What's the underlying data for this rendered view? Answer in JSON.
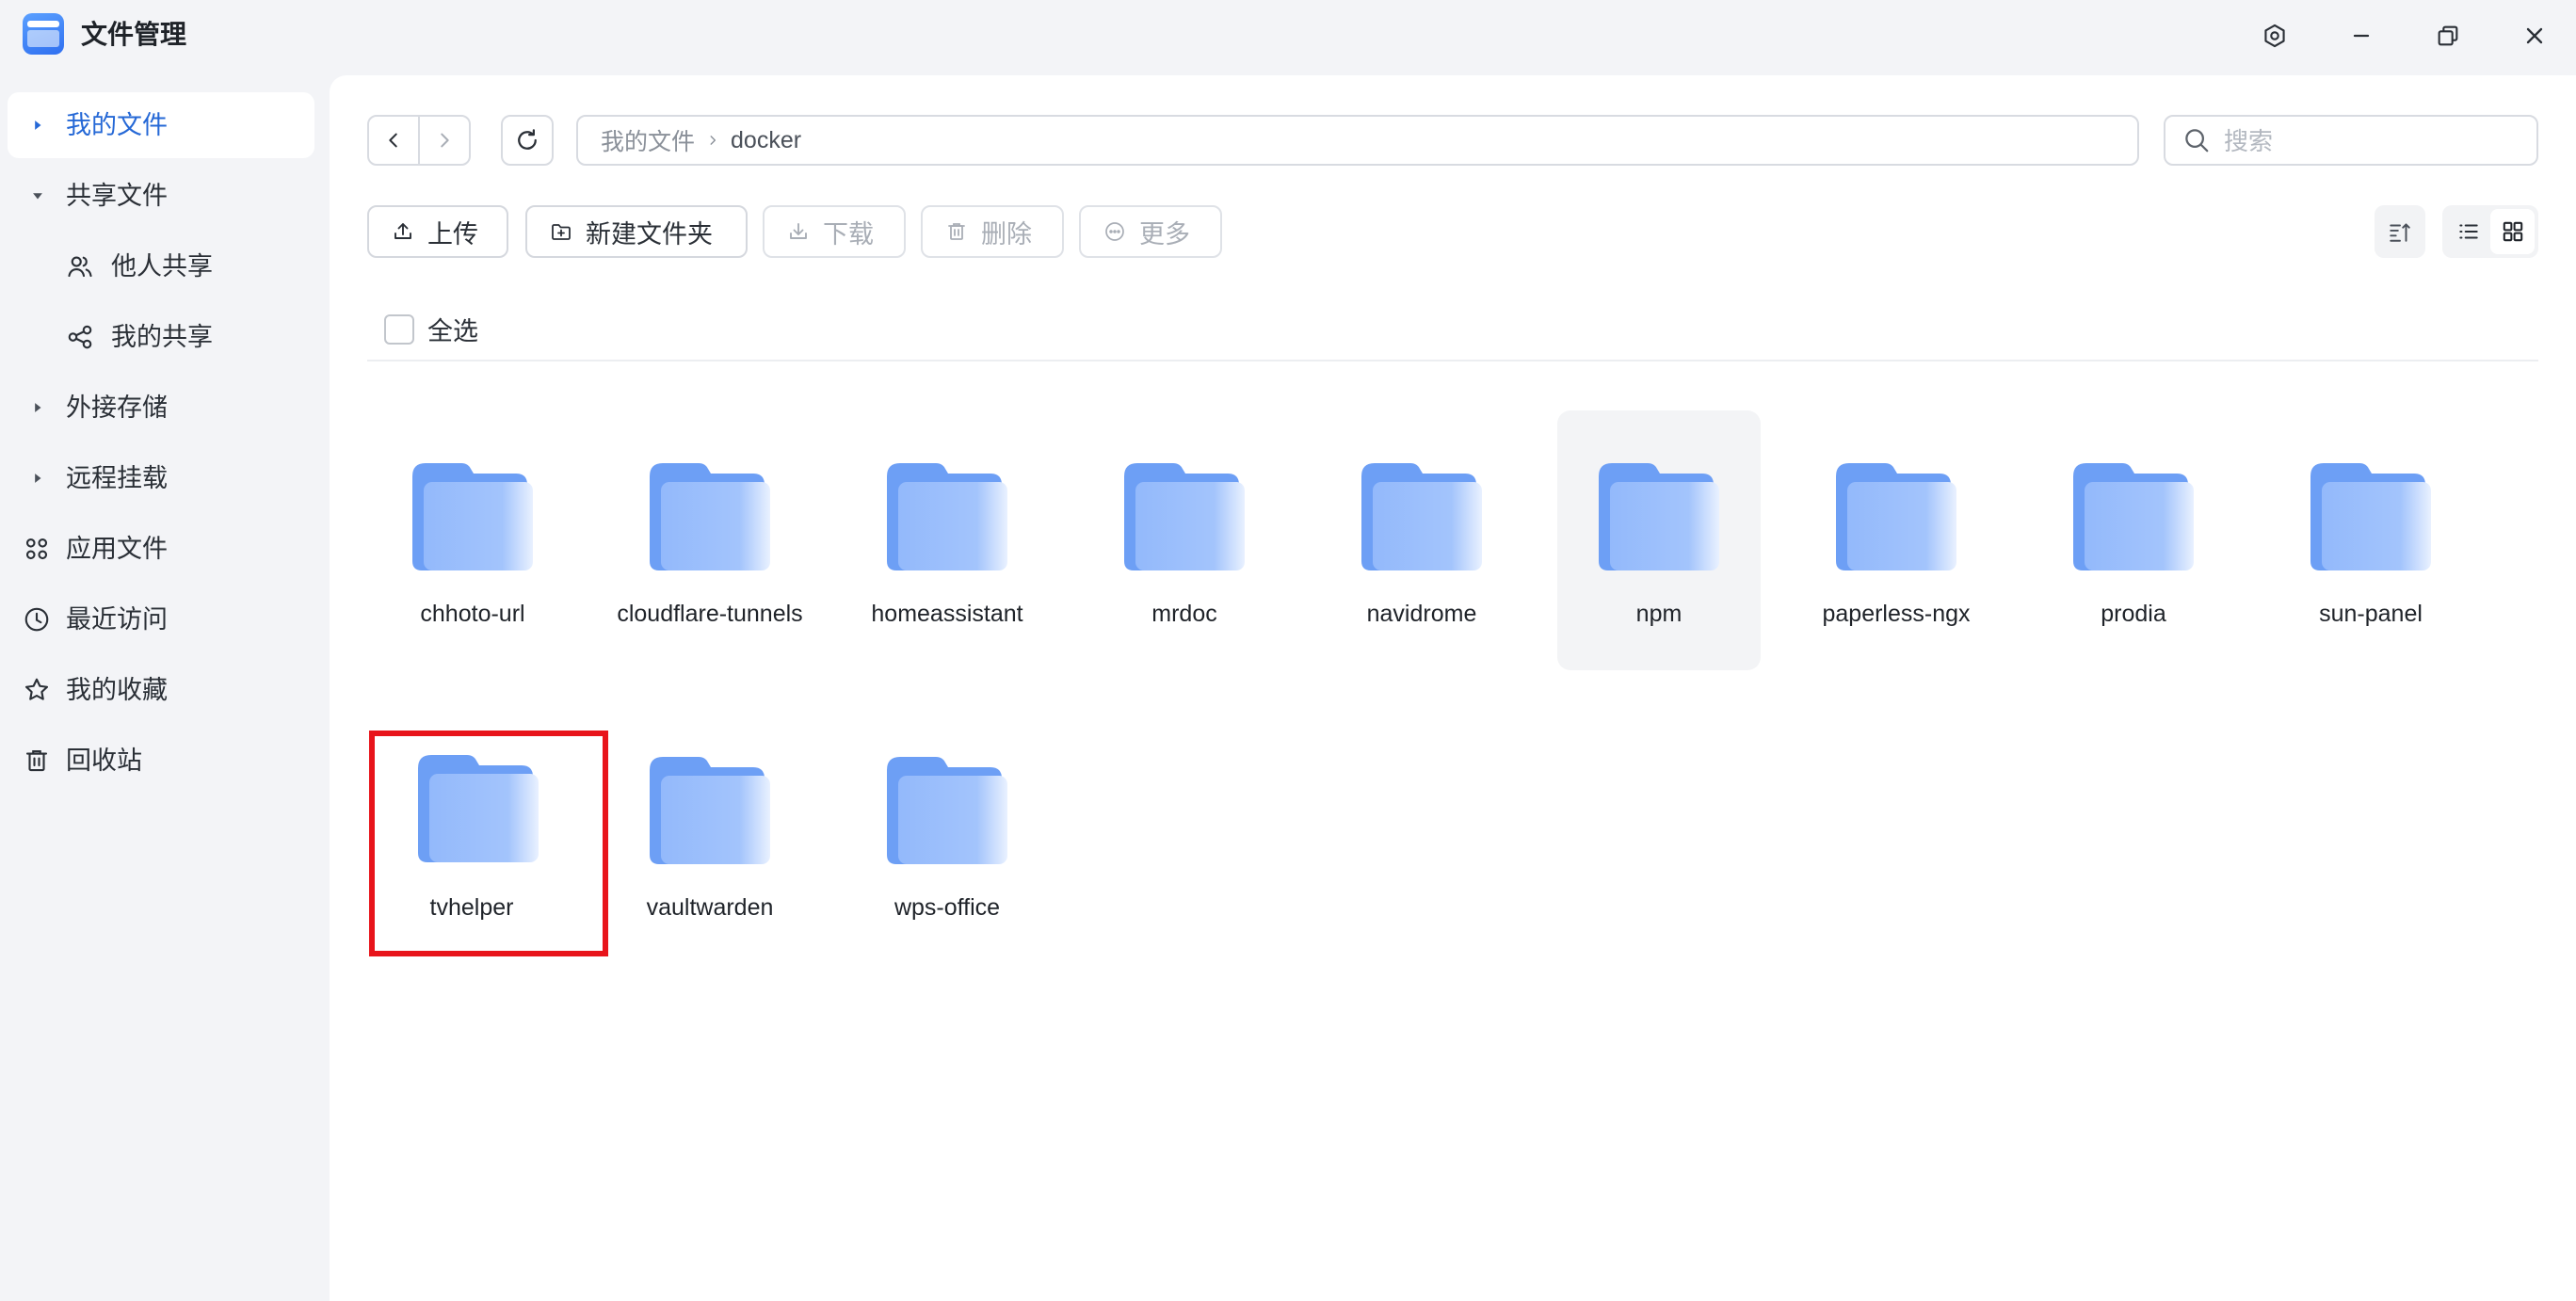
{
  "app": {
    "title": "文件管理"
  },
  "sidebar": {
    "items": [
      {
        "label": "我的文件"
      },
      {
        "label": "共享文件"
      },
      {
        "label": "他人共享"
      },
      {
        "label": "我的共享"
      },
      {
        "label": "外接存储"
      },
      {
        "label": "远程挂载"
      },
      {
        "label": "应用文件"
      },
      {
        "label": "最近访问"
      },
      {
        "label": "我的收藏"
      },
      {
        "label": "回收站"
      }
    ]
  },
  "breadcrumb": {
    "root": "我的文件",
    "current": "docker"
  },
  "search": {
    "placeholder": "搜索"
  },
  "toolbar": {
    "upload": "上传",
    "new_folder": "新建文件夹",
    "download": "下载",
    "delete": "删除",
    "more": "更多"
  },
  "select_all": "全选",
  "files": [
    {
      "name": "chhoto-url"
    },
    {
      "name": "cloudflare-tunnels"
    },
    {
      "name": "homeassistant"
    },
    {
      "name": "mrdoc"
    },
    {
      "name": "navidrome"
    },
    {
      "name": "npm"
    },
    {
      "name": "paperless-ngx"
    },
    {
      "name": "prodia"
    },
    {
      "name": "sun-panel"
    },
    {
      "name": "tvhelper"
    },
    {
      "name": "vaultwarden"
    },
    {
      "name": "wps-office"
    }
  ],
  "colors": {
    "accent": "#2568d6",
    "folder_back": "#6d9ff5",
    "folder_front": "#9fc1fb",
    "highlight_border": "#e8141b"
  }
}
